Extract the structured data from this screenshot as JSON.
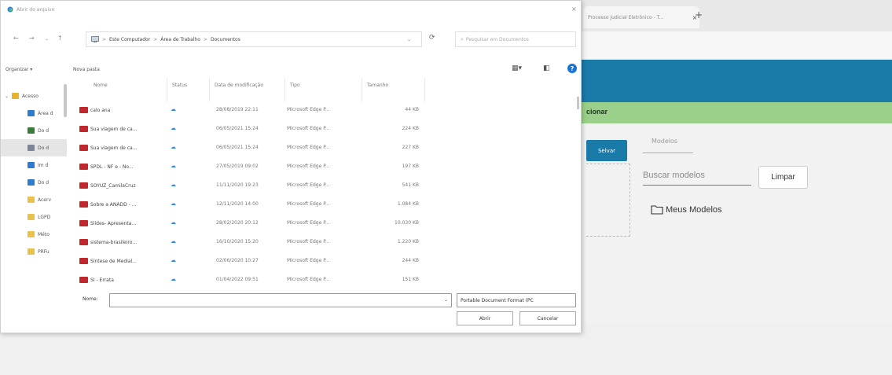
{
  "browser": {
    "tab_title": "Processo Judicial Eletrônico - T...",
    "tab_close": "×",
    "new_tab": "+"
  },
  "app": {
    "green_bar_label": "cionar",
    "select_button": "Selvar",
    "models_tab": "Modelos",
    "search_placeholder": "Buscar modelos",
    "clear_button": "Limpar",
    "my_models": "Meus Modelos",
    "header_color": "#1a7aa8",
    "green_color": "#9bd08a"
  },
  "dialog": {
    "title": "Abrir do arquivo",
    "close": "×",
    "breadcrumb": [
      "Este Computador",
      "Área de Trabalho",
      "Documentos"
    ],
    "breadcrumb_sep": ">",
    "search_placeholder": "Pesquisar em Documentos",
    "toolbar": {
      "organize": "Organizar ▾",
      "new_folder": "Nova pasta"
    },
    "nav_items": [
      {
        "label": "Acesso",
        "icon": "star-icon",
        "color": "#e8b22a"
      },
      {
        "label": "Àrea d",
        "icon": "desktop-icon",
        "color": "#2e7bcf"
      },
      {
        "label": "Do d",
        "icon": "download-icon",
        "color": "#3a7a3a"
      },
      {
        "label": "Do d",
        "icon": "documents-icon",
        "color": "#7b8796"
      },
      {
        "label": "Im d",
        "icon": "pictures-icon",
        "color": "#2e7bcf"
      },
      {
        "label": "Do d",
        "icon": "music-icon",
        "color": "#2e7bcf"
      },
      {
        "label": "Acerv",
        "icon": "folder-icon",
        "color": "#e8c24a"
      },
      {
        "label": "LGPD",
        "icon": "folder-icon",
        "color": "#e8c24a"
      },
      {
        "label": "Méto",
        "icon": "folder-icon",
        "color": "#e8c24a"
      },
      {
        "label": "PRFu",
        "icon": "folder-icon",
        "color": "#e8c24a"
      }
    ],
    "columns": {
      "name": "Nome",
      "status": "Status",
      "date": "Data de modificação",
      "type": "Tipo",
      "size": "Tamanho"
    },
    "files": [
      {
        "name": "calo ana",
        "date": "28/08/2019 22:11",
        "type": "Microsoft Edge P...",
        "size": "44 KB"
      },
      {
        "name": "Sua viagem de ca...",
        "date": "06/05/2021 15:24",
        "type": "Microsoft Edge P...",
        "size": "224 KB"
      },
      {
        "name": "Sua viagem de ca...",
        "date": "06/05/2021 15:24",
        "type": "Microsoft Edge P...",
        "size": "227 KB"
      },
      {
        "name": "SPDL - NF e - No...",
        "date": "27/05/2019 09:02",
        "type": "Microsoft Edge P...",
        "size": "197 KB"
      },
      {
        "name": "SOYUZ_CamilaCruz",
        "date": "11/11/2020 19:23",
        "type": "Microsoft Edge P...",
        "size": "541 KB"
      },
      {
        "name": "Sobre a ANADD - ...",
        "date": "12/11/2020 14:00",
        "type": "Microsoft Edge P...",
        "size": "1.084 KB"
      },
      {
        "name": "Slides- Apresenta...",
        "date": "28/02/2020 20:12",
        "type": "Microsoft Edge P...",
        "size": "10.030 KB"
      },
      {
        "name": "sistema-brasileiro...",
        "date": "16/10/2020 15:20",
        "type": "Microsoft Edge P...",
        "size": "1.220 KB"
      },
      {
        "name": "Síntese de Medial...",
        "date": "02/06/2020 10:27",
        "type": "Microsoft Edge P...",
        "size": "244 KB"
      },
      {
        "name": "SI - Errata",
        "date": "01/04/2022 09:51",
        "type": "Microsoft Edge P...",
        "size": "151 KB"
      }
    ],
    "file_name_label": "Nome:",
    "file_name_value": "",
    "file_type": "Portable Document Format (PC",
    "open_button": "Abrir",
    "cancel_button": "Cancelar"
  }
}
